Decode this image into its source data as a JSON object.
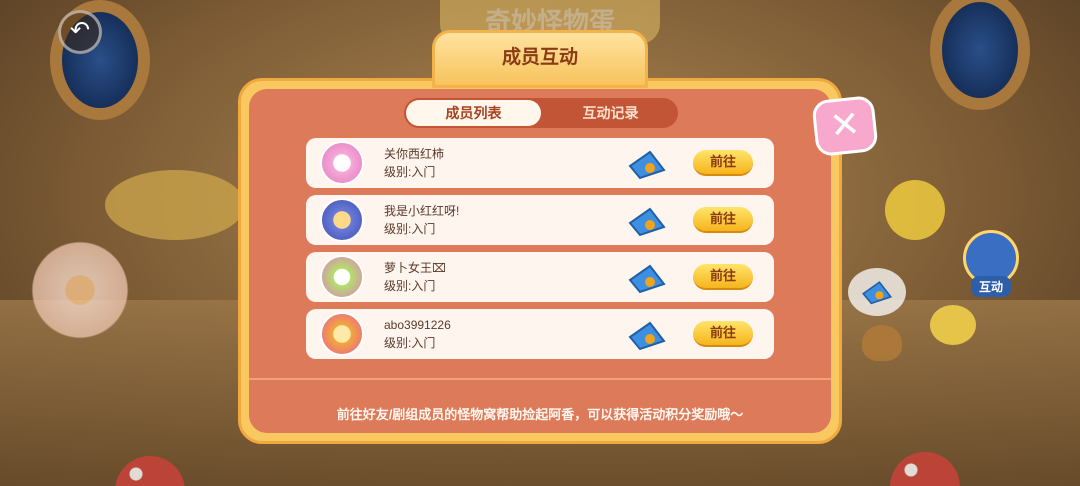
{
  "background": {
    "title": "奇妙怪物蛋",
    "back_icon": "back-arrow-icon",
    "side_button_label": "互动"
  },
  "panel": {
    "title": "成员互动",
    "tabs": [
      {
        "label": "成员列表",
        "active": true
      },
      {
        "label": "互动记录",
        "active": false
      }
    ],
    "close_icon": "close-x-icon",
    "members": [
      {
        "name": "关你西红柿",
        "level": "级别:入门",
        "go_label": "前往",
        "avatar_color": "#f7a8d8"
      },
      {
        "name": "我是小红红呀!",
        "level": "级别:入门",
        "go_label": "前往",
        "avatar_color": "#6a7bd8"
      },
      {
        "name": "萝卜女王⌧",
        "level": "级别:入门",
        "go_label": "前往",
        "avatar_color": "#b4e06a"
      },
      {
        "name": "abo3991226",
        "level": "级别:入门",
        "go_label": "前往",
        "avatar_color": "#f2a83c"
      }
    ],
    "footer": "前往好友/剧组成员的怪物窝帮助捡起阿香，可以获得活动积分奖励哦～"
  },
  "colors": {
    "panel_outer": "#f9c861",
    "panel_inner": "#dd7a5a",
    "go_button": "#f6b41c",
    "close_button": "#f8a8cd"
  }
}
